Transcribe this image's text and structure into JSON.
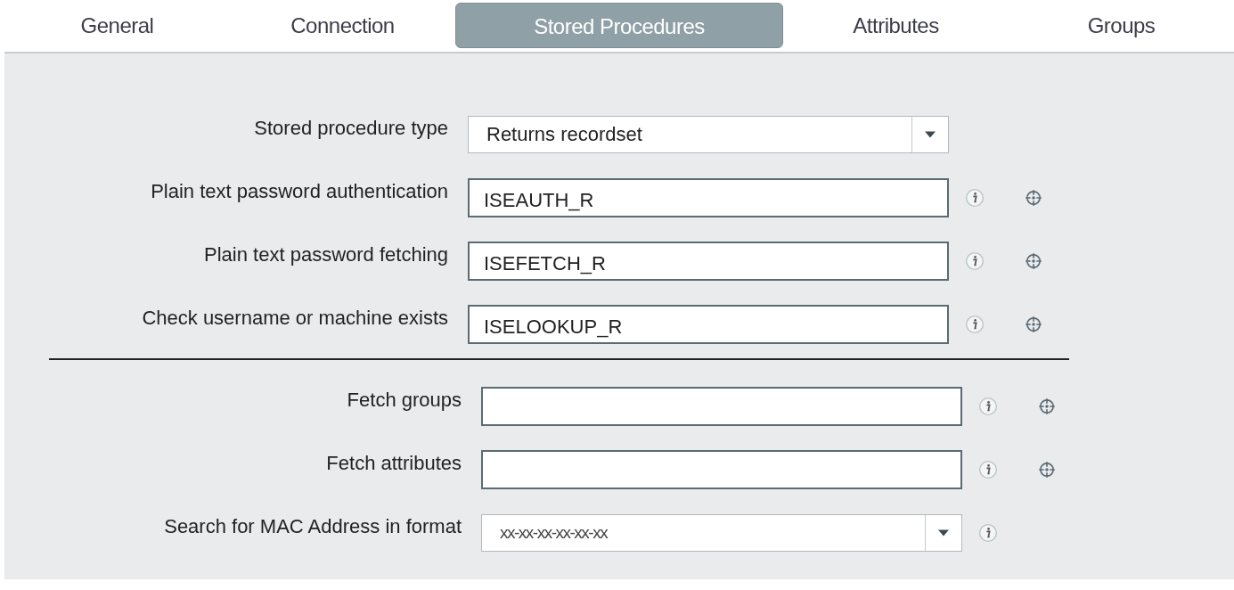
{
  "tabs": [
    {
      "label": "General",
      "selected": false
    },
    {
      "label": "Connection",
      "selected": false
    },
    {
      "label": "Stored Procedures",
      "selected": true
    },
    {
      "label": "Attributes",
      "selected": false
    },
    {
      "label": "Groups",
      "selected": false
    }
  ],
  "groups": [
    {
      "rows": [
        {
          "label": "Stored procedure type",
          "kind": "select",
          "value": "Returns recordset",
          "info": false,
          "target": false
        },
        {
          "label": "Plain text password authentication",
          "kind": "text",
          "value": "ISEAUTH_R",
          "info": true,
          "target": true
        },
        {
          "label": "Plain text password fetching",
          "kind": "text",
          "value": "ISEFETCH_R",
          "info": true,
          "target": true
        },
        {
          "label": "Check username or machine exists",
          "kind": "text",
          "value": "ISELOOKUP_R",
          "info": true,
          "target": true
        }
      ]
    },
    {
      "rows": [
        {
          "label": "Fetch groups",
          "kind": "text",
          "value": "",
          "info": true,
          "target": true
        },
        {
          "label": "Fetch attributes",
          "kind": "text",
          "value": "",
          "info": true,
          "target": true
        },
        {
          "label": "Search for MAC Address in format",
          "kind": "select-small",
          "value": "xx-xx-xx-xx-xx-xx",
          "info": true,
          "target": false
        }
      ]
    }
  ]
}
